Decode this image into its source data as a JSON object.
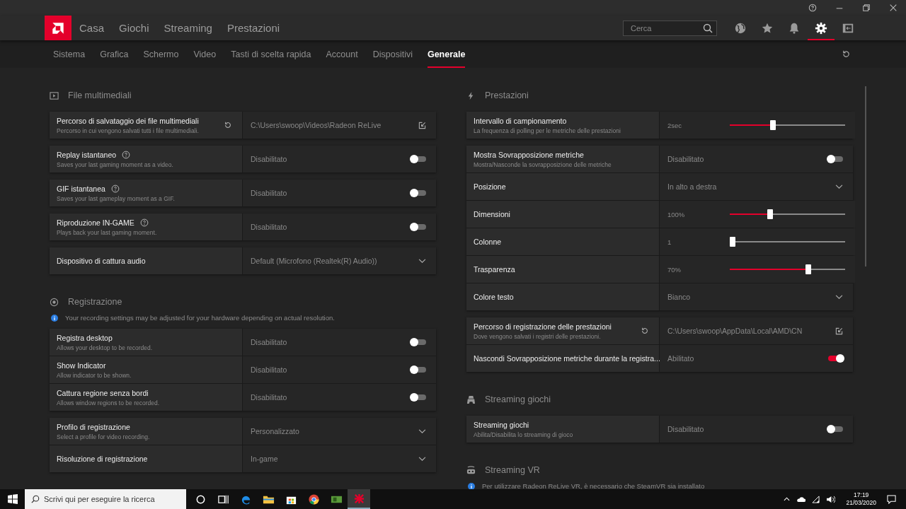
{
  "nav": [
    {
      "label": "Casa"
    },
    {
      "label": "Giochi"
    },
    {
      "label": "Streaming"
    },
    {
      "label": "Prestazioni"
    }
  ],
  "search": {
    "placeholder": "Cerca"
  },
  "header_icons": [
    {
      "kind": "globe",
      "selected": false
    },
    {
      "kind": "star",
      "selected": false
    },
    {
      "kind": "bell",
      "selected": false
    },
    {
      "kind": "gear",
      "selected": true
    },
    {
      "kind": "panel",
      "selected": false
    }
  ],
  "tabs": [
    {
      "label": "Sistema",
      "selected": false
    },
    {
      "label": "Grafica",
      "selected": false
    },
    {
      "label": "Schermo",
      "selected": false
    },
    {
      "label": "Video",
      "selected": false
    },
    {
      "label": "Tasti di scelta rapida",
      "selected": false
    },
    {
      "label": "Account",
      "selected": false
    },
    {
      "label": "Dispositivi",
      "selected": false
    },
    {
      "label": "Generale",
      "selected": true
    }
  ],
  "columns": [
    [
      {
        "kind": "media",
        "title": "File multimediali",
        "groups": [
          [
            {
              "kind": "path",
              "label": "Percorso di salvataggio dei file multimediali",
              "description": "Percorso in cui vengono salvati tutti i file multimediali.",
              "help": false,
              "value": "C:\\Users\\swoop\\Videos\\Radeon ReLive"
            }
          ],
          [
            {
              "kind": "toggle",
              "label": "Replay istantaneo",
              "description": "Saves your last gaming moment as a video.",
              "help": true,
              "value": "Disabilitato",
              "on": false
            }
          ],
          [
            {
              "kind": "toggle",
              "label": "GIF istantanea",
              "description": "Saves your last gameplay moment as a GIF.",
              "help": true,
              "value": "Disabilitato",
              "on": false
            }
          ],
          [
            {
              "kind": "toggle",
              "label": "Riproduzione IN-GAME",
              "description": "Plays back your last gaming moment.",
              "help": true,
              "value": "Disabilitato",
              "on": false
            }
          ],
          [
            {
              "kind": "dropdown",
              "label": "Dispositivo di cattura audio",
              "help": false,
              "value": "Default (Microfono (Realtek(R) Audio))"
            }
          ]
        ]
      },
      {
        "kind": "record",
        "title": "Registrazione",
        "info": "Your recording settings may be adjusted for your hardware depending on actual resolution.",
        "groups": [
          [
            {
              "kind": "toggle",
              "label": "Registra desktop",
              "description": "Allows your desktop to be recorded.",
              "help": false,
              "value": "Disabilitato",
              "on": false
            },
            {
              "kind": "toggle",
              "label": "Show Indicator",
              "description": "Allow indicator to be shown.",
              "help": false,
              "value": "Disabilitato",
              "on": false
            },
            {
              "kind": "toggle",
              "label": "Cattura regione senza bordi",
              "description": "Allows window regions to be recorded.",
              "help": false,
              "value": "Disabilitato",
              "on": false
            }
          ],
          [
            {
              "kind": "dropdown",
              "label": "Profilo di registrazione",
              "description": "Select a profile for video recording.",
              "help": false,
              "value": "Personalizzato"
            },
            {
              "kind": "dropdown",
              "label": "Risoluzione di registrazione",
              "help": false,
              "value": "In-game"
            }
          ]
        ]
      }
    ],
    [
      {
        "kind": "bolt",
        "title": "Prestazioni",
        "groups": [
          [
            {
              "kind": "slider",
              "label": "Intervallo di campionamento",
              "description": "La frequenza di polling per le metriche delle prestazioni",
              "help": false,
              "value": "2sec",
              "level": 0.37
            }
          ],
          [
            {
              "kind": "toggle",
              "label": "Mostra Sovrapposizione metriche",
              "description": "Mostra/Nasconde la sovrapposizione delle metriche",
              "help": false,
              "value": "Disabilitato",
              "on": false
            },
            {
              "kind": "dropdown",
              "label": "Posizione",
              "help": false,
              "value": "In alto a destra"
            },
            {
              "kind": "slider",
              "label": "Dimensioni",
              "help": false,
              "value": "100%",
              "level": 0.34
            },
            {
              "kind": "slider",
              "label": "Colonne",
              "help": false,
              "value": "1",
              "level": 0
            },
            {
              "kind": "slider",
              "label": "Trasparenza",
              "help": false,
              "value": "70%",
              "level": 0.69
            },
            {
              "kind": "dropdown",
              "label": "Colore testo",
              "help": false,
              "value": "Bianco"
            }
          ],
          [
            {
              "kind": "path",
              "label": "Percorso di registrazione delle prestazioni",
              "description": "Dove vengono salvati i registri delle prestazioni.",
              "help": false,
              "value": "C:\\Users\\swoop\\AppData\\Local\\AMD\\CN"
            },
            {
              "kind": "toggle",
              "label": "Nascondi Sovrapposizione metriche durante la registra...",
              "help": false,
              "value": "Abilitato",
              "on": true
            }
          ]
        ]
      },
      {
        "kind": "gamepad",
        "title": "Streaming giochi",
        "groups": [
          [
            {
              "kind": "toggle",
              "label": "Streaming giochi",
              "description": "Abilita/Disabilita lo streaming di gioco",
              "help": false,
              "value": "Disabilitato",
              "on": false
            }
          ]
        ]
      },
      {
        "kind": "vr",
        "title": "Streaming VR",
        "info": "Per utilizzare Radeon ReLive VR, è necessario che SteamVR sia installato"
      }
    ]
  ],
  "taskbar": {
    "search_placeholder": "Scrivi qui per eseguire la ricerca",
    "apps": [
      {
        "kind": "cortana",
        "selected": false
      },
      {
        "kind": "taskview",
        "selected": false
      },
      {
        "kind": "edge",
        "selected": false
      },
      {
        "kind": "folder",
        "selected": false
      },
      {
        "kind": "store",
        "selected": false
      },
      {
        "kind": "chrome",
        "selected": false
      },
      {
        "kind": "card",
        "selected": false
      },
      {
        "kind": "amd",
        "selected": true
      }
    ],
    "time": "17:19",
    "date": "21/03/2020"
  }
}
